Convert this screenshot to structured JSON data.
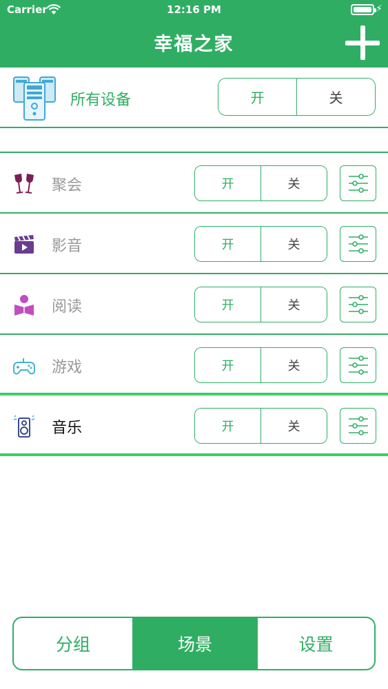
{
  "status_bar": {
    "carrier": "Carrier",
    "time": "12:16 PM"
  },
  "nav": {
    "title": "幸福之家",
    "add_icon": "plus-icon"
  },
  "colors": {
    "primary": "#2fae63",
    "accent_line": "#3ccf62"
  },
  "all_devices": {
    "label": "所有设备",
    "on": "开",
    "off": "关",
    "icon": "devices-icon"
  },
  "scenes": [
    {
      "label": "聚会",
      "icon": "wine-glasses-icon",
      "on": "开",
      "off": "关"
    },
    {
      "label": "影音",
      "icon": "clapperboard-icon",
      "on": "开",
      "off": "关"
    },
    {
      "label": "阅读",
      "icon": "reader-icon",
      "on": "开",
      "off": "关"
    },
    {
      "label": "游戏",
      "icon": "gamepad-icon",
      "on": "开",
      "off": "关"
    },
    {
      "label": "音乐",
      "icon": "speaker-icon",
      "on": "开",
      "off": "关"
    }
  ],
  "tabs": [
    {
      "label": "分组",
      "selected": false
    },
    {
      "label": "场景",
      "selected": true
    },
    {
      "label": "设置",
      "selected": false
    }
  ]
}
